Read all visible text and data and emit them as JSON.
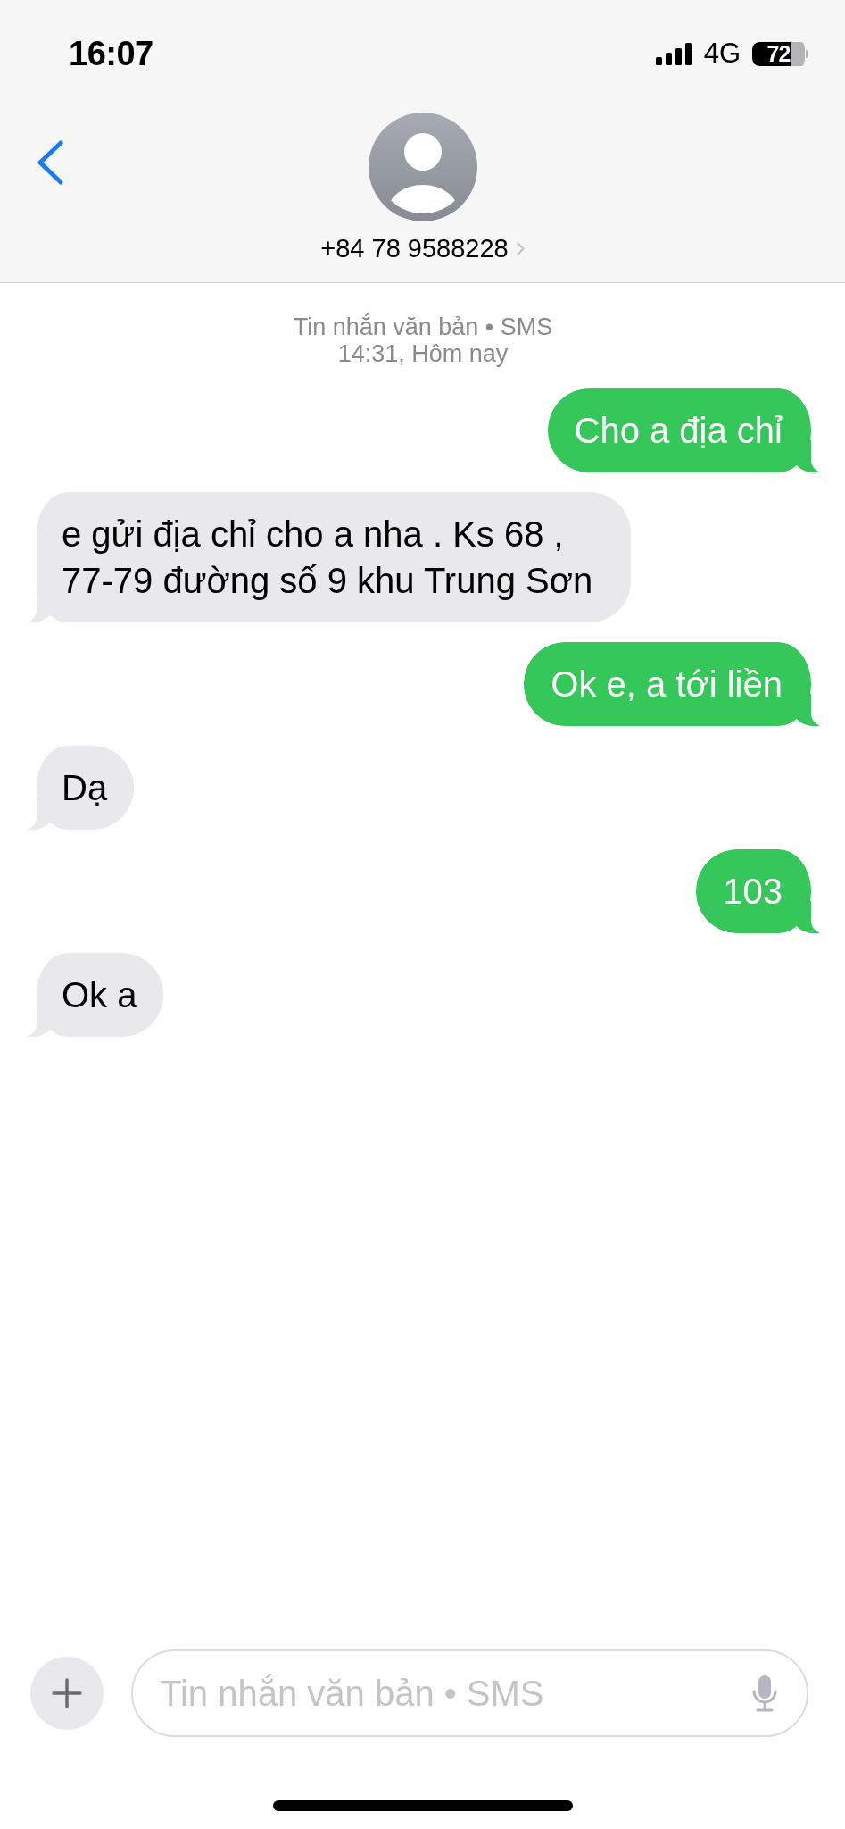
{
  "status_bar": {
    "time": "16:07",
    "network": "4G",
    "battery": "72"
  },
  "header": {
    "contact": "+84 78 9588228"
  },
  "conversation": {
    "service": "Tin nhắn văn bản • SMS",
    "timestamp": "14:31, Hôm nay",
    "messages": [
      {
        "kind": "sent",
        "text": "Cho a địa chỉ"
      },
      {
        "kind": "received",
        "text": "e gửi địa chỉ cho a nha . Ks 68 , 77-79 đường số 9 khu Trung Sơn"
      },
      {
        "kind": "sent",
        "text": "Ok e, a tới liền"
      },
      {
        "kind": "received",
        "text": "Dạ"
      },
      {
        "kind": "sent",
        "text": "103"
      },
      {
        "kind": "received",
        "text": "Ok a"
      }
    ]
  },
  "composer": {
    "placeholder": "Tin nhắn văn bản • SMS"
  }
}
